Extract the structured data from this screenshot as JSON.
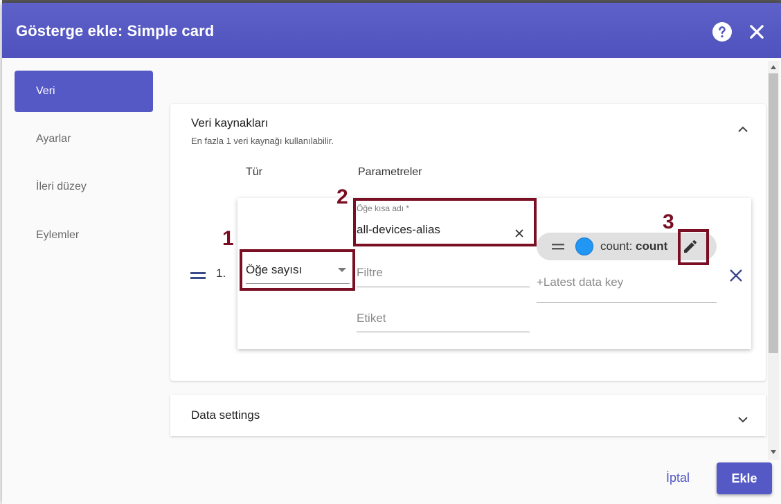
{
  "dialog": {
    "title": "Gösterge ekle: Simple card",
    "help_icon": "help-circle-icon",
    "close_icon": "close-icon"
  },
  "sidebar": {
    "items": [
      {
        "label": "Veri",
        "active": true
      },
      {
        "label": "Ayarlar",
        "active": false
      },
      {
        "label": "İleri düzey",
        "active": false
      },
      {
        "label": "Eylemler",
        "active": false
      }
    ]
  },
  "datasources": {
    "title": "Veri kaynakları",
    "subtitle": "En fazla 1 veri kaynağı kullanılabilir.",
    "col_type": "Tür",
    "col_params": "Parametreler",
    "row": {
      "index": "1.",
      "type_value": "Öğe sayısı",
      "alias_label": "Öğe kısa adı *",
      "alias_value": "all-devices-alias",
      "filter_placeholder": "Filtre",
      "label_placeholder": "Etiket",
      "key_chip_name": "count",
      "key_chip_label": "count",
      "key_chip_color": "#2196f3",
      "latest_key_placeholder": "+Latest data key"
    }
  },
  "data_settings": {
    "title": "Data settings"
  },
  "annotations": [
    "1",
    "2",
    "3"
  ],
  "footer": {
    "cancel_label": "İptal",
    "add_label": "Ekle"
  },
  "colors": {
    "primary": "#5559c6",
    "annotation": "#7a0f24"
  }
}
